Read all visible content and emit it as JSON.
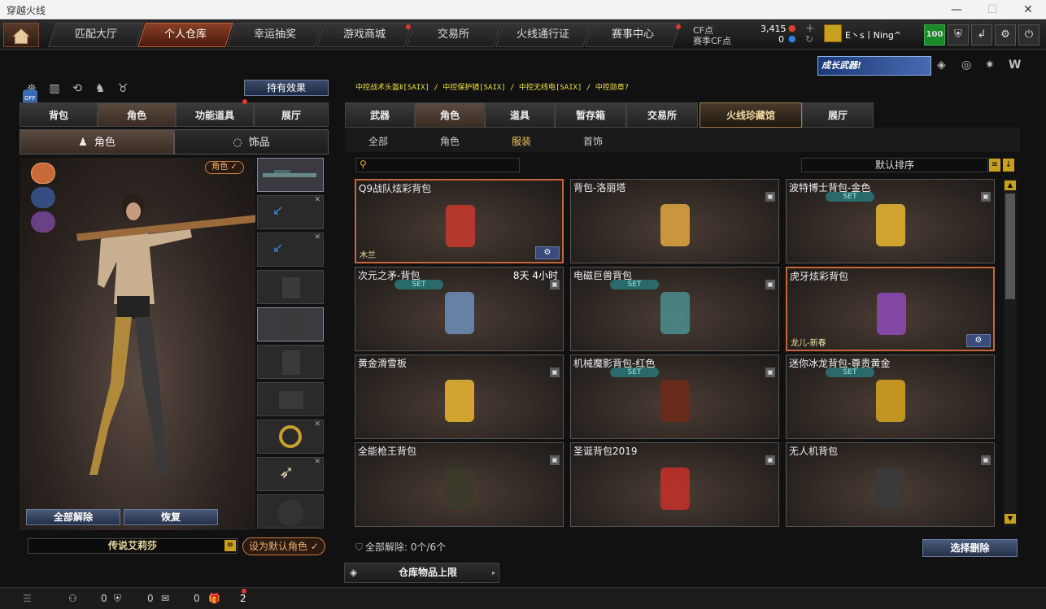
{
  "window": {
    "title": "穿越火线",
    "controls": [
      "min",
      "max",
      "close"
    ]
  },
  "topnav": {
    "tabs": [
      {
        "label": "匹配大厅",
        "active": false,
        "dot": false
      },
      {
        "label": "个人仓库",
        "active": true,
        "dot": false
      },
      {
        "label": "幸运抽奖",
        "active": false,
        "dot": false
      },
      {
        "label": "游戏商城",
        "active": false,
        "dot": true
      },
      {
        "label": "交易所",
        "active": false,
        "dot": false
      },
      {
        "label": "火线通行证",
        "active": false,
        "dot": false
      },
      {
        "label": "赛事中心",
        "active": false,
        "dot": true
      }
    ],
    "cf_label": "CF点",
    "cf_value": "3,415",
    "season_label": "赛季CF点",
    "season_value": "0",
    "username": "E丶s丨Ning^",
    "level": "100"
  },
  "promo": {
    "text": "成长武器!"
  },
  "left": {
    "effect_button": "持有效果",
    "toggle_off": "OFF",
    "tabs": [
      "背包",
      "角色",
      "功能道具",
      "展厅"
    ],
    "active_tab": 1,
    "subtabs": [
      "角色",
      "饰品"
    ],
    "char_tag": "角色 ✓",
    "unequip_all": "全部解除",
    "restore": "恢复",
    "char_name": "传说艾莉莎",
    "set_default": "设为默认角色"
  },
  "right": {
    "notice": "中控战术头盔Ⅱ[SAIX] / 中控保护镜[SAIX] / 中控无线电[SAIX] / 中控勋章?",
    "tabs": [
      "武器",
      "角色",
      "道具",
      "暂存箱",
      "交易所",
      "火线珍藏馆",
      "展厅"
    ],
    "active_tab": 1,
    "subtabs": [
      "全部",
      "角色",
      "服装",
      "首饰"
    ],
    "active_subtab": 2,
    "sort": "默认排序",
    "items": [
      {
        "name": "Q9战队炫彩背包",
        "owner": "木兰",
        "highlight": true,
        "gear": true,
        "set": false,
        "lock": false,
        "time": ""
      },
      {
        "name": "背包-洛丽塔",
        "owner": "",
        "highlight": false,
        "gear": false,
        "set": false,
        "lock": true,
        "time": ""
      },
      {
        "name": "波特博士背包-金色",
        "owner": "",
        "highlight": false,
        "gear": false,
        "set": true,
        "lock": true,
        "time": ""
      },
      {
        "name": "次元之矛-背包",
        "owner": "",
        "highlight": false,
        "gear": false,
        "set": true,
        "lock": true,
        "time": "8天 4小时"
      },
      {
        "name": "电磁巨兽背包",
        "owner": "",
        "highlight": false,
        "gear": false,
        "set": true,
        "lock": true,
        "time": ""
      },
      {
        "name": "虎牙炫彩背包",
        "owner": "龙儿-新春",
        "highlight": true,
        "gear": true,
        "set": false,
        "lock": false,
        "time": ""
      },
      {
        "name": "黄金滑雪板",
        "owner": "",
        "highlight": false,
        "gear": false,
        "set": false,
        "lock": true,
        "time": ""
      },
      {
        "name": "机械魔影背包-红色",
        "owner": "",
        "highlight": false,
        "gear": false,
        "set": true,
        "lock": true,
        "time": ""
      },
      {
        "name": "迷你冰龙背包-尊贵黄金",
        "owner": "",
        "highlight": false,
        "gear": false,
        "set": true,
        "lock": false,
        "time": ""
      },
      {
        "name": "全能枪王背包",
        "owner": "",
        "highlight": false,
        "gear": false,
        "set": false,
        "lock": true,
        "time": ""
      },
      {
        "name": "圣诞背包2019",
        "owner": "",
        "highlight": false,
        "gear": false,
        "set": false,
        "lock": true,
        "time": ""
      },
      {
        "name": "无人机背包",
        "owner": "",
        "highlight": false,
        "gear": false,
        "set": false,
        "lock": true,
        "time": ""
      }
    ],
    "set_label": "SET",
    "bulk_label": "全部解除: 0个/6个",
    "delete_button": "选择删除",
    "capacity": "仓库物品上限"
  },
  "bottombar": {
    "friends": "0",
    "shield": "0",
    "chat": "0",
    "gift": "2"
  }
}
